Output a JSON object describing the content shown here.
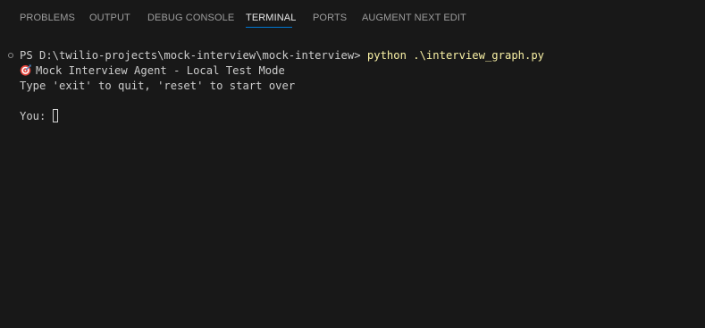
{
  "panel": {
    "tabs": [
      {
        "label": "PROBLEMS"
      },
      {
        "label": "OUTPUT"
      },
      {
        "label": "DEBUG CONSOLE"
      },
      {
        "label": "TERMINAL"
      },
      {
        "label": "PORTS"
      },
      {
        "label": "AUGMENT NEXT EDIT"
      }
    ],
    "active_tab": "TERMINAL"
  },
  "terminal": {
    "prompt": "PS D:\\twilio-projects\\mock-interview\\mock-interview> ",
    "command": "python .\\interview_graph.py",
    "output_line_1_icon": "target-icon",
    "output_line_1": "Mock Interview Agent - Local Test Mode",
    "output_line_2": "Type 'exit' to quit, 'reset' to start over",
    "input_prompt": "You: "
  },
  "colors": {
    "background": "#181818",
    "command": "#f9f1a5",
    "text": "#cccccc",
    "active_tab_underline": "#0078d4"
  }
}
